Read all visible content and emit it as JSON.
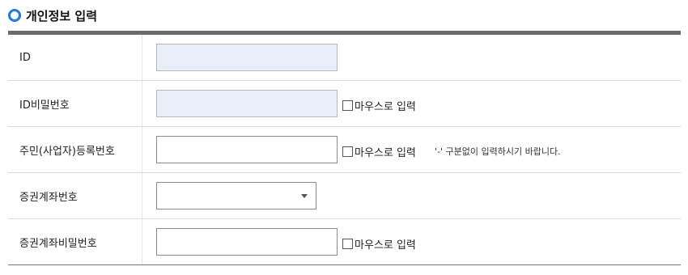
{
  "section": {
    "title": "개인정보 입력",
    "icon": "ring-icon",
    "accent": "#1f7ad9"
  },
  "rows": [
    {
      "label": "ID",
      "input_value": ""
    },
    {
      "label": "ID비밀번호",
      "input_value": "",
      "mouse_label": "마우스로 입력"
    },
    {
      "label": "주민(사업자)등록번호",
      "input_value": "",
      "mouse_label": "마우스로 입력",
      "hint": "'-' 구분없이 입력하시기 바랍니다."
    },
    {
      "label": "증권계좌번호",
      "selected": ""
    },
    {
      "label": "증권계좌비밀번호",
      "input_value": "",
      "mouse_label": "마우스로 입력"
    }
  ]
}
